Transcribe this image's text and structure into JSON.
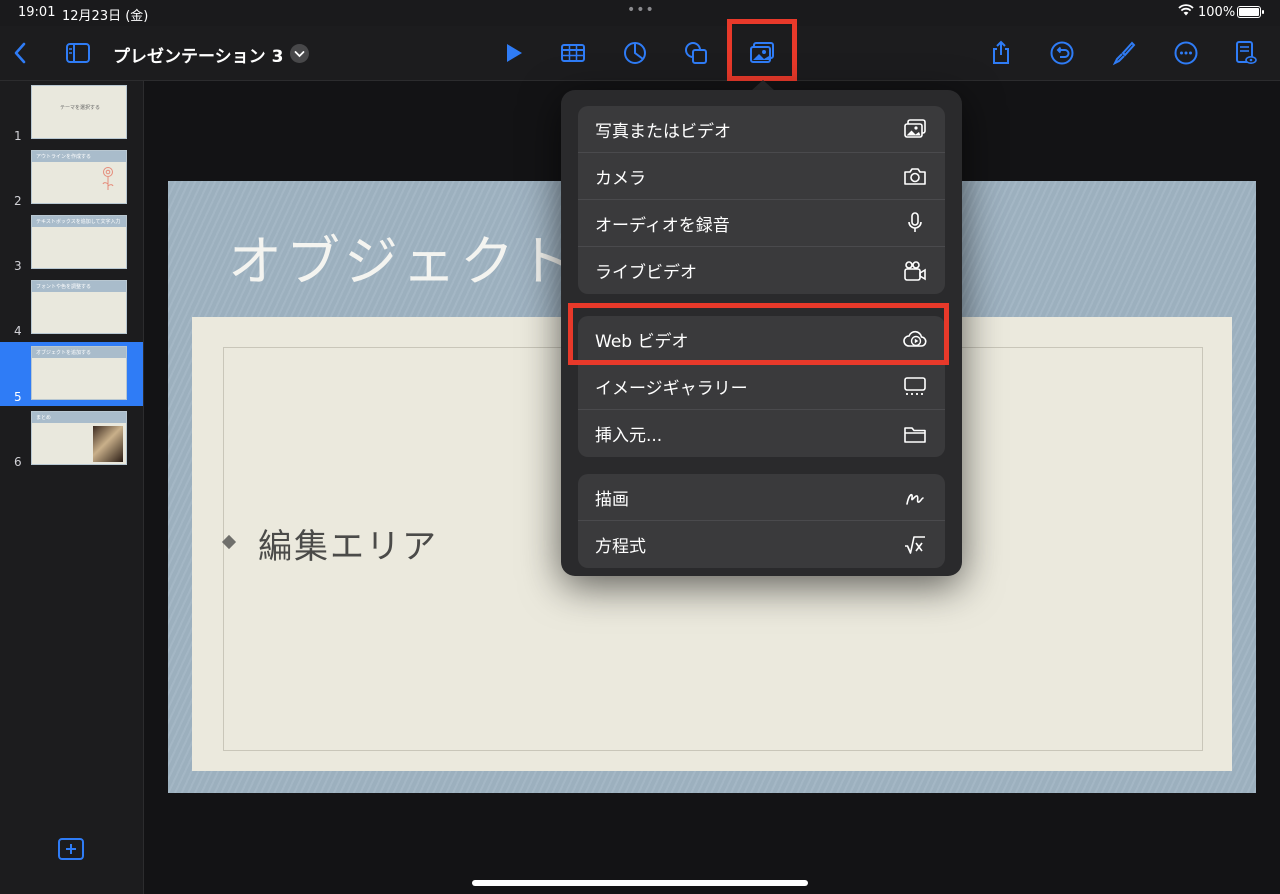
{
  "status_bar": {
    "time": "19:01",
    "date": "12月23日 (金)",
    "battery": "100%"
  },
  "toolbar": {
    "document_title": "プレゼンテーション 3"
  },
  "slides": [
    {
      "number": "1",
      "title": "テーマを選択する",
      "style": "plain"
    },
    {
      "number": "2",
      "title": "アウトラインを作成する",
      "style": "banded"
    },
    {
      "number": "3",
      "title": "テキストボックスを追加して文字入力",
      "style": "banded"
    },
    {
      "number": "4",
      "title": "フォントや色を調整する",
      "style": "banded"
    },
    {
      "number": "5",
      "title": "オブジェクトを追加する",
      "style": "banded",
      "selected": true
    },
    {
      "number": "6",
      "title": "まとめ",
      "style": "banded"
    }
  ],
  "slide": {
    "title": "オブジェクト",
    "body_text": "編集エリア"
  },
  "insert_menu": {
    "group1": [
      {
        "label": "写真またはビデオ",
        "icon": "photo-video-icon"
      },
      {
        "label": "カメラ",
        "icon": "camera-icon"
      },
      {
        "label": "オーディオを録音",
        "icon": "microphone-icon"
      },
      {
        "label": "ライブビデオ",
        "icon": "live-video-icon"
      }
    ],
    "group2": [
      {
        "label": "Web ビデオ",
        "icon": "cloud-play-icon"
      },
      {
        "label": "イメージギャラリー",
        "icon": "image-gallery-icon"
      },
      {
        "label": "挿入元...",
        "icon": "folder-icon"
      }
    ],
    "group3": [
      {
        "label": "描画",
        "icon": "drawing-icon"
      },
      {
        "label": "方程式",
        "icon": "equation-icon"
      }
    ]
  },
  "colors": {
    "accent": "#2f7cf6",
    "highlight": "#e8392a",
    "background": "#1c1c1e"
  }
}
